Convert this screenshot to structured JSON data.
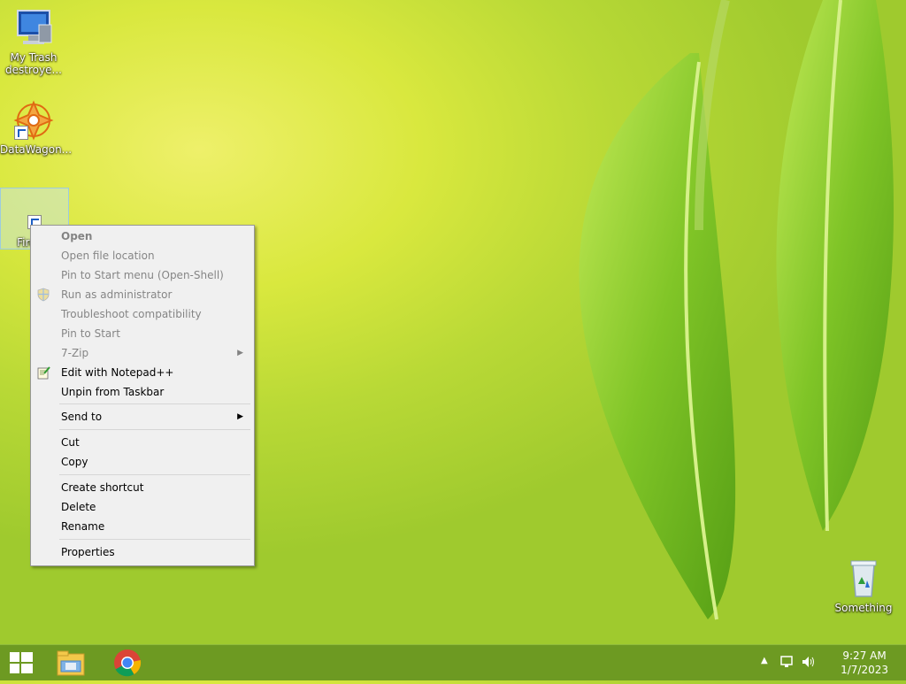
{
  "desktop": {
    "icons": [
      {
        "label": "My Trash\ndestroye..."
      },
      {
        "label": "DataWagon..."
      },
      {
        "label": "Firefox"
      },
      {
        "label": "Something"
      }
    ]
  },
  "context_menu": {
    "items": [
      {
        "label": "Open"
      },
      {
        "label": "Open file location"
      },
      {
        "label": "Pin to Start menu (Open-Shell)"
      },
      {
        "label": "Run as administrator"
      },
      {
        "label": "Troubleshoot compatibility"
      },
      {
        "label": "Pin to Start"
      },
      {
        "label": "7-Zip"
      },
      {
        "label": "Edit with Notepad++"
      },
      {
        "label": "Unpin from Taskbar"
      },
      {
        "label": "Send to"
      },
      {
        "label": "Cut"
      },
      {
        "label": "Copy"
      },
      {
        "label": "Create shortcut"
      },
      {
        "label": "Delete"
      },
      {
        "label": "Rename"
      },
      {
        "label": "Properties"
      }
    ]
  },
  "taskbar": {
    "apps": [
      "start-icon",
      "file-explorer-icon",
      "chrome-icon"
    ],
    "clock": {
      "time": "9:27 AM",
      "date": "1/7/2023"
    },
    "tray_icons": [
      "show-hidden-icons",
      "network-icon",
      "volume-icon"
    ]
  },
  "colors": {
    "accent": "#6d9a22",
    "wallpaper": "#cfe13a"
  }
}
